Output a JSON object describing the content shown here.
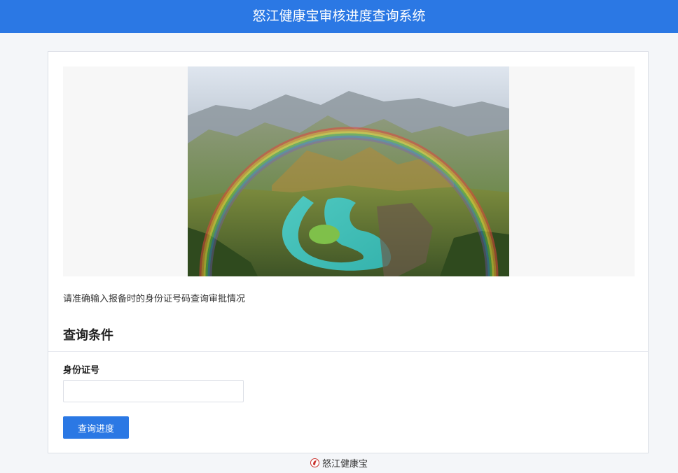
{
  "header": {
    "title": "怒江健康宝审核进度查询系统",
    "background": "#2b78e4"
  },
  "banner": {
    "image": "rainbow-over-river-bend-photo"
  },
  "instruction": "请准确输入报备时的身份证号码查询审批情况",
  "form": {
    "section_title": "查询条件",
    "id_label": "身份证号",
    "id_value": "",
    "id_placeholder": "",
    "submit_label": "查询进度",
    "accent": "#2b78e4"
  },
  "footer": {
    "logo_icon": "nujiang-health-logo-icon",
    "text": "怒江健康宝"
  }
}
